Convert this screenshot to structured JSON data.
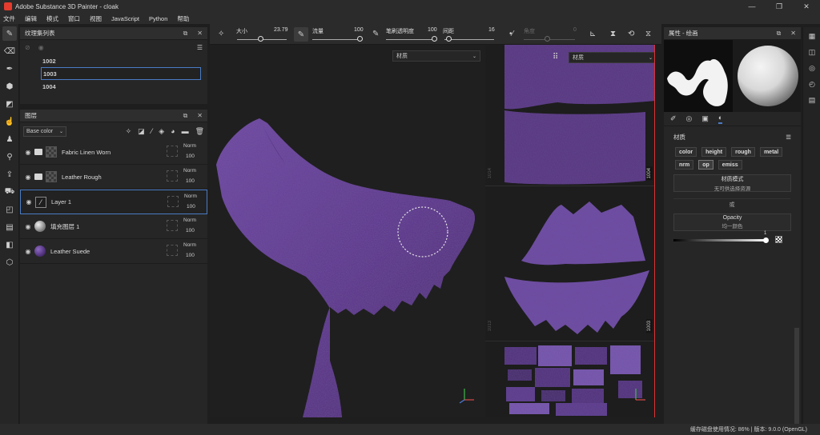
{
  "app": {
    "title": "Adobe Substance 3D Painter - cloak"
  },
  "window": {
    "minimize": "—",
    "maximize": "❐",
    "close": "✕"
  },
  "menu": [
    "文件",
    "编辑",
    "模式",
    "窗口",
    "视图",
    "JavaScript",
    "Python",
    "帮助"
  ],
  "tools": [
    {
      "icon": "paint-brush-icon",
      "glyph": "✎",
      "active": true
    },
    {
      "icon": "eraser-icon",
      "glyph": "⌫",
      "active": false
    },
    {
      "icon": "projection-icon",
      "glyph": "✒",
      "active": false
    },
    {
      "icon": "geometry-fill-icon",
      "glyph": "⬢",
      "active": false
    },
    {
      "icon": "polygon-fill-icon",
      "glyph": "◩",
      "active": false
    },
    {
      "icon": "smudge-icon",
      "glyph": "☝",
      "active": false
    },
    {
      "icon": "clone-icon",
      "glyph": "♟",
      "active": false
    },
    {
      "icon": "color-picker-icon",
      "glyph": "⚲",
      "active": false
    },
    {
      "icon": "bake-icon",
      "glyph": "⇪",
      "active": false
    },
    {
      "icon": "export-icon",
      "glyph": "⛟",
      "active": false
    },
    {
      "icon": "assets-icon",
      "glyph": "◰",
      "active": false
    },
    {
      "icon": "library-icon",
      "glyph": "▤",
      "active": false
    },
    {
      "icon": "display-icon",
      "glyph": "◧",
      "active": false
    },
    {
      "icon": "shelf-icon",
      "glyph": "⬡",
      "active": false
    }
  ],
  "texture_sets": {
    "title": "纹理集列表",
    "items": [
      {
        "label": "1002",
        "selected": false
      },
      {
        "label": "1003",
        "selected": true
      },
      {
        "label": "1004",
        "selected": false
      }
    ]
  },
  "layers": {
    "title": "图层",
    "channel": "Base color",
    "rows": [
      {
        "name": "Fabric Linen Worn",
        "kind": "folder",
        "blend": "Norm",
        "opacity": "100",
        "selected": false
      },
      {
        "name": "Leather Rough",
        "kind": "folder",
        "blend": "Norm",
        "opacity": "100",
        "selected": false
      },
      {
        "name": "Layer 1",
        "kind": "paint",
        "blend": "Norm",
        "opacity": "100",
        "selected": true
      },
      {
        "name": "填充图层 1",
        "kind": "fill",
        "blend": "Norm",
        "opacity": "100",
        "selected": false
      },
      {
        "name": "Leather Suede",
        "kind": "material",
        "blend": "Norm",
        "opacity": "100",
        "selected": false
      }
    ]
  },
  "toolbar": {
    "size_label": "大小",
    "size_value": "23.79",
    "flow_label": "流量",
    "flow_value": "100",
    "stroke_opacity_label": "笔刷透明度",
    "stroke_opacity_value": "100",
    "spacing_label": "间距",
    "spacing_value": "16",
    "angle_label": "角度",
    "angle_value": "0"
  },
  "viewport3d": {
    "mode": "材质"
  },
  "viewport2d": {
    "mode": "材质",
    "tags": [
      "1004",
      "1003",
      "1014",
      "1013"
    ]
  },
  "properties": {
    "title": "属性 - 绘画",
    "section": "材质",
    "channels_row1": [
      "color",
      "height",
      "rough",
      "metal"
    ],
    "channels_row2": [
      "nrm",
      "op",
      "emiss"
    ],
    "active_channel": "op",
    "material_mode_label": "材质模式",
    "material_mode_value": "无可供选择资源",
    "or_label": "或",
    "opacity_label": "Opacity",
    "opacity_value": "均一颜色",
    "gradient_value": "1"
  },
  "status": {
    "text": "缓存磁盘使用情况: 86% | 版本: 9.0.0 (OpenGL)"
  },
  "colors": {
    "accent": "#4a7bc4",
    "cloth": "#5b3a8c",
    "viewport_border": "#dd3333"
  }
}
